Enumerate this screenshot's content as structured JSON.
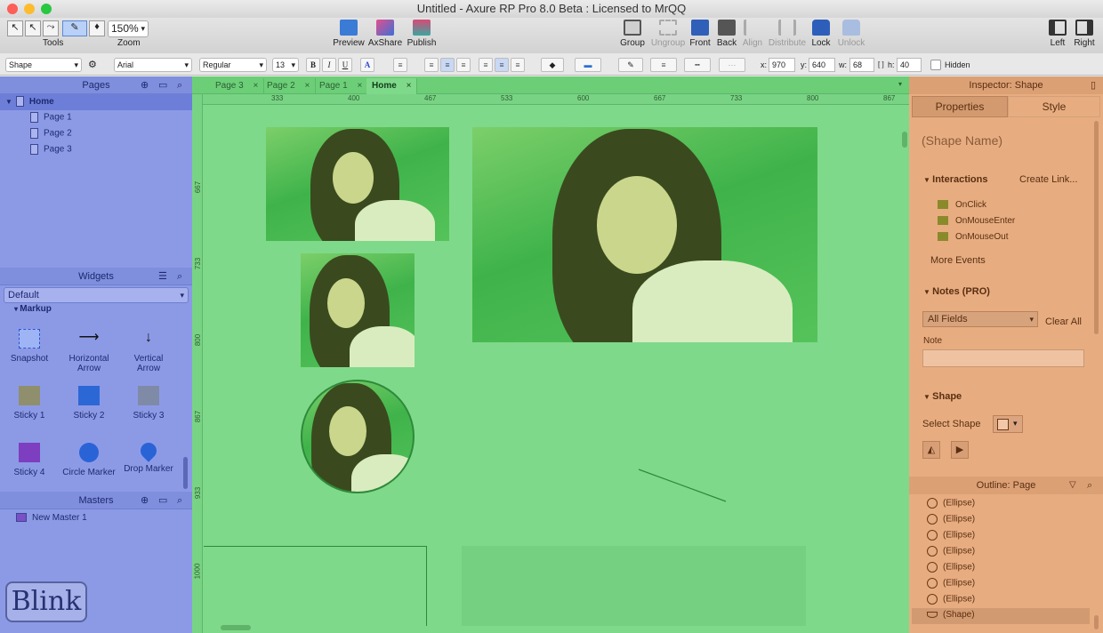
{
  "window": {
    "title": "Untitled - Axure RP Pro 8.0 Beta : Licensed to MrQQ"
  },
  "toolbar": {
    "tools_label": "Tools",
    "zoom_value": "150%",
    "zoom_label": "Zoom",
    "buttons": [
      "Preview",
      "AxShare",
      "Publish",
      "Group",
      "Ungroup",
      "Front",
      "Back",
      "Align",
      "Distribute",
      "Lock",
      "Unlock",
      "Left",
      "Right"
    ]
  },
  "format": {
    "style_select": "Shape",
    "font_family": "Arial",
    "font_weight": "Regular",
    "font_size": "13",
    "bold": "B",
    "italic": "I",
    "underline": "U",
    "x_label": "x:",
    "x": "970",
    "y_label": "y:",
    "y": "640",
    "w_label": "w:",
    "w": "68",
    "h_label": "h:",
    "h": "40",
    "hidden_label": "Hidden"
  },
  "pages_panel": {
    "title": "Pages",
    "home": "Home",
    "pages": [
      "Page 1",
      "Page 2",
      "Page 3"
    ]
  },
  "widgets_panel": {
    "title": "Widgets",
    "library": "Default",
    "group": "Markup",
    "items": [
      "Snapshot",
      "Horizontal Arrow",
      "Vertical Arrow",
      "Sticky 1",
      "Sticky 2",
      "Sticky 3",
      "Sticky 4",
      "Circle Marker",
      "Drop Marker"
    ]
  },
  "masters_panel": {
    "title": "Masters",
    "items": [
      "New Master 1"
    ]
  },
  "logo": "Blink",
  "canvas": {
    "tabs": [
      "Page 3",
      "Page 2",
      "Page 1",
      "Home"
    ],
    "active_tab": "Home",
    "h_ruler": [
      "333",
      "400",
      "467",
      "533",
      "600",
      "667",
      "733",
      "800",
      "867"
    ],
    "v_ruler": [
      "667",
      "733",
      "800",
      "867",
      "933",
      "1000"
    ]
  },
  "inspector": {
    "title": "Inspector: Shape",
    "tab_properties": "Properties",
    "tab_style": "Style",
    "shape_name_placeholder": "(Shape Name)",
    "interactions_title": "Interactions",
    "create_link": "Create Link...",
    "events": [
      "OnClick",
      "OnMouseEnter",
      "OnMouseOut"
    ],
    "more_events": "More Events",
    "notes_title": "Notes (PRO)",
    "notes_filter": "All Fields",
    "clear_all": "Clear All",
    "note_label": "Note",
    "shape_title": "Shape",
    "select_shape": "Select Shape"
  },
  "outline": {
    "title": "Outline: Page",
    "items": [
      "(Ellipse)",
      "(Ellipse)",
      "(Ellipse)",
      "(Ellipse)",
      "(Ellipse)",
      "(Ellipse)",
      "(Ellipse)",
      "(Shape)"
    ]
  }
}
